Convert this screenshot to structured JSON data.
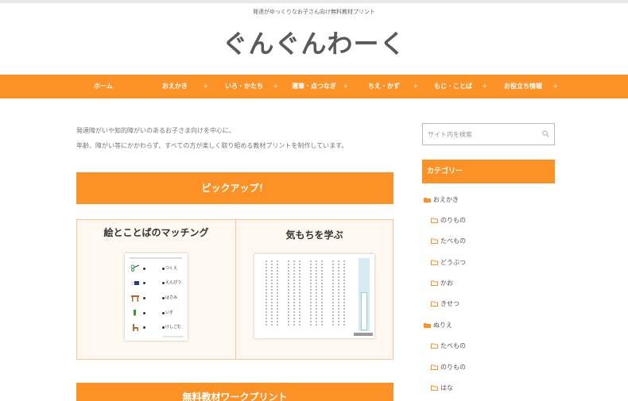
{
  "header": {
    "tagline": "発達がゆっくりなお子さん向け無料教材プリント",
    "title": "ぐんぐんわーく"
  },
  "nav": {
    "items": [
      {
        "label": "ホーム"
      },
      {
        "label": "おえかき"
      },
      {
        "label": "いろ・かたち"
      },
      {
        "label": "運筆・点つなぎ"
      },
      {
        "label": "ちえ・かず"
      },
      {
        "label": "もじ・ことば"
      },
      {
        "label": "お役立ち情報"
      }
    ],
    "plus_glyph": "+"
  },
  "main": {
    "intro_line1": "発達障がいや知的障がいのあるお子さま向けを中心に、",
    "intro_line2": "年齢、障がい等にかかわらず、すべての方が楽しく取り組める教材プリントを制作しています。",
    "pickup_title": "ピックアップ！",
    "cards": [
      {
        "title": "絵とことばのマッチング",
        "words": [
          "つくえ",
          "えんぴつ",
          "はさみ",
          "いす",
          "けしごむ"
        ]
      },
      {
        "title": "気もちを学ぶ"
      }
    ],
    "free_title": "無料教材ワークプリント"
  },
  "sidebar": {
    "search_placeholder": "サイト内を検索",
    "category_heading": "カテゴリー",
    "categories": [
      {
        "label": "おえかき",
        "level": 0
      },
      {
        "label": "のりもの",
        "level": 1
      },
      {
        "label": "たべもの",
        "level": 1
      },
      {
        "label": "どうぶつ",
        "level": 1
      },
      {
        "label": "かお",
        "level": 1
      },
      {
        "label": "きせつ",
        "level": 1
      },
      {
        "label": "ぬりえ",
        "level": 0
      },
      {
        "label": "たべもの",
        "level": 1
      },
      {
        "label": "のりもの",
        "level": 1
      },
      {
        "label": "はな",
        "level": 1
      }
    ]
  },
  "colors": {
    "accent": "#fc9226",
    "card_bg": "#fef8f1",
    "card_border": "#f9c795"
  }
}
